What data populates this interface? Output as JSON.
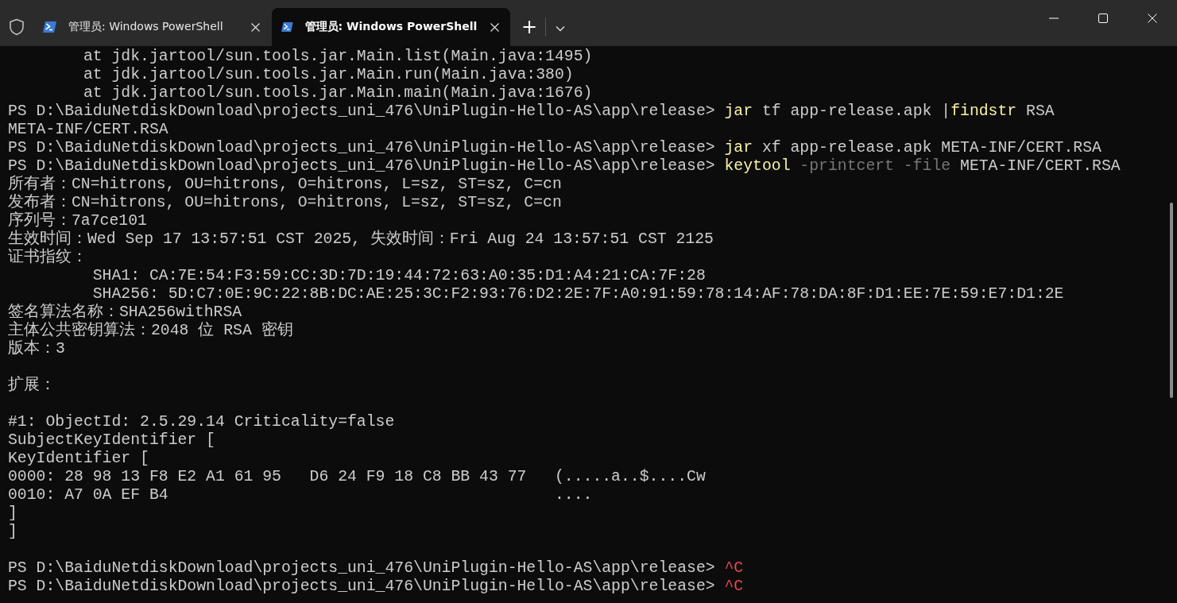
{
  "tabs": [
    {
      "title": "管理员: Windows PowerShell",
      "selected": false
    },
    {
      "title": "管理员: Windows PowerShell",
      "selected": true
    }
  ],
  "new_tab_button": "+",
  "terminal": {
    "lines": [
      {
        "segments": [
          {
            "kind": "plain",
            "text": "        at jdk.jartool/sun.tools.jar.Main.list(Main.java:1495)"
          }
        ]
      },
      {
        "segments": [
          {
            "kind": "plain",
            "text": "        at jdk.jartool/sun.tools.jar.Main.run(Main.java:380)"
          }
        ]
      },
      {
        "segments": [
          {
            "kind": "plain",
            "text": "        at jdk.jartool/sun.tools.jar.Main.main(Main.java:1676)"
          }
        ]
      },
      {
        "segments": [
          {
            "kind": "plain",
            "text": "PS D:\\BaiduNetdiskDownload\\projects_uni_476\\UniPlugin-Hello-AS\\app\\release> "
          },
          {
            "kind": "command",
            "text": "jar"
          },
          {
            "kind": "plain",
            "text": " tf app-release.apk |"
          },
          {
            "kind": "command",
            "text": "findstr"
          },
          {
            "kind": "plain",
            "text": " RSA"
          }
        ]
      },
      {
        "segments": [
          {
            "kind": "plain",
            "text": "META-INF/CERT.RSA"
          }
        ]
      },
      {
        "segments": [
          {
            "kind": "plain",
            "text": "PS D:\\BaiduNetdiskDownload\\projects_uni_476\\UniPlugin-Hello-AS\\app\\release> "
          },
          {
            "kind": "command",
            "text": "jar"
          },
          {
            "kind": "plain",
            "text": " xf app-release.apk META-INF/CERT.RSA"
          }
        ]
      },
      {
        "segments": [
          {
            "kind": "plain",
            "text": "PS D:\\BaiduNetdiskDownload\\projects_uni_476\\UniPlugin-Hello-AS\\app\\release> "
          },
          {
            "kind": "command",
            "text": "keytool"
          },
          {
            "kind": "param",
            "text": " -printcert -file"
          },
          {
            "kind": "plain",
            "text": " META-INF/CERT.RSA"
          }
        ]
      },
      {
        "segments": [
          {
            "kind": "plain",
            "text": "所有者：CN=hitrons, OU=hitrons, O=hitrons, L=sz, ST=sz, C=cn"
          }
        ]
      },
      {
        "segments": [
          {
            "kind": "plain",
            "text": "发布者：CN=hitrons, OU=hitrons, O=hitrons, L=sz, ST=sz, C=cn"
          }
        ]
      },
      {
        "segments": [
          {
            "kind": "plain",
            "text": "序列号：7a7ce101"
          }
        ]
      },
      {
        "segments": [
          {
            "kind": "plain",
            "text": "生效时间：Wed Sep 17 13:57:51 CST 2025, 失效时间：Fri Aug 24 13:57:51 CST 2125"
          }
        ]
      },
      {
        "segments": [
          {
            "kind": "plain",
            "text": "证书指纹："
          }
        ]
      },
      {
        "segments": [
          {
            "kind": "plain",
            "text": "         SHA1: CA:7E:54:F3:59:CC:3D:7D:19:44:72:63:A0:35:D1:A4:21:CA:7F:28"
          }
        ]
      },
      {
        "segments": [
          {
            "kind": "plain",
            "text": "         SHA256: 5D:C7:0E:9C:22:8B:DC:AE:25:3C:F2:93:76:D2:2E:7F:A0:91:59:78:14:AF:78:DA:8F:D1:EE:7E:59:E7:D1:2E"
          }
        ]
      },
      {
        "segments": [
          {
            "kind": "plain",
            "text": "签名算法名称：SHA256withRSA"
          }
        ]
      },
      {
        "segments": [
          {
            "kind": "plain",
            "text": "主体公共密钥算法：2048 位 RSA 密钥"
          }
        ]
      },
      {
        "segments": [
          {
            "kind": "plain",
            "text": "版本：3"
          }
        ]
      },
      {
        "kind": "blank"
      },
      {
        "segments": [
          {
            "kind": "plain",
            "text": "扩展："
          }
        ]
      },
      {
        "kind": "blank"
      },
      {
        "segments": [
          {
            "kind": "plain",
            "text": "#1: ObjectId: 2.5.29.14 Criticality=false"
          }
        ]
      },
      {
        "segments": [
          {
            "kind": "plain",
            "text": "SubjectKeyIdentifier ["
          }
        ]
      },
      {
        "segments": [
          {
            "kind": "plain",
            "text": "KeyIdentifier ["
          }
        ]
      },
      {
        "segments": [
          {
            "kind": "plain",
            "text": "0000: 28 98 13 F8 E2 A1 61 95   D6 24 F9 18 C8 BB 43 77   (.....a..$....Cw"
          }
        ]
      },
      {
        "segments": [
          {
            "kind": "plain",
            "text": "0010: A7 0A EF B4                                         ...."
          }
        ]
      },
      {
        "segments": [
          {
            "kind": "plain",
            "text": "]"
          }
        ]
      },
      {
        "segments": [
          {
            "kind": "plain",
            "text": "]"
          }
        ]
      },
      {
        "kind": "blank"
      },
      {
        "segments": [
          {
            "kind": "plain",
            "text": "PS D:\\BaiduNetdiskDownload\\projects_uni_476\\UniPlugin-Hello-AS\\app\\release> "
          },
          {
            "kind": "error",
            "text": "^C"
          }
        ]
      },
      {
        "segments": [
          {
            "kind": "plain",
            "text": "PS D:\\BaiduNetdiskDownload\\projects_uni_476\\UniPlugin-Hello-AS\\app\\release> "
          },
          {
            "kind": "error",
            "text": "^C"
          }
        ]
      }
    ]
  }
}
